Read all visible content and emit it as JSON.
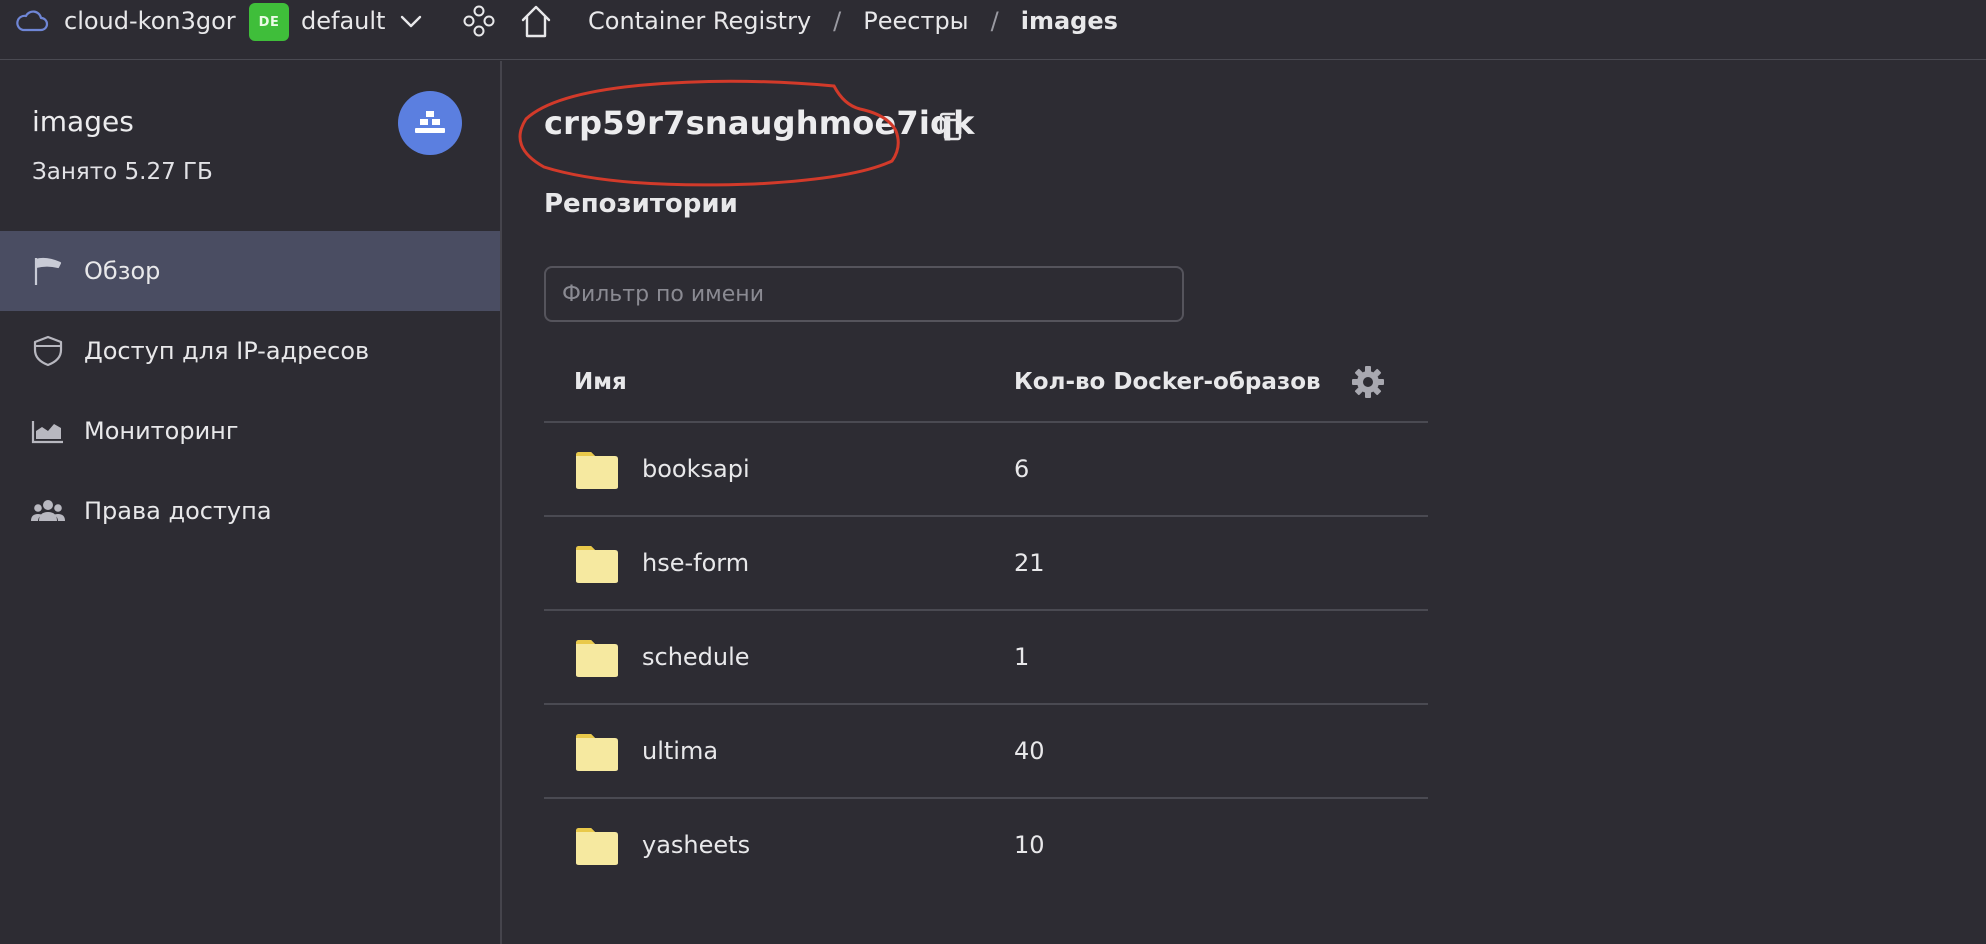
{
  "topbar": {
    "cloud_icon": "cloud-icon",
    "cloud_name": "cloud-kon3gor",
    "folder_badge": "DE",
    "folder_name": "default",
    "apps_icon": "services-icon",
    "home_icon": "home-icon",
    "breadcrumbs": [
      "Container Registry",
      "Реестры",
      "images"
    ]
  },
  "sidebar": {
    "title": "images",
    "usage": "Занято 5.27 ГБ",
    "avatar_icon": "registry-icon",
    "avatar_color": "#5b7fe0",
    "items": [
      {
        "label": "Обзор",
        "icon": "flag-icon",
        "active": true
      },
      {
        "label": "Доступ для IP-адресов",
        "icon": "shield-icon",
        "active": false
      },
      {
        "label": "Мониторинг",
        "icon": "chart-icon",
        "active": false
      },
      {
        "label": "Права доступа",
        "icon": "users-icon",
        "active": false
      }
    ]
  },
  "main": {
    "registry_id": "crp59r7snaughmoe7iqk",
    "annotation_color": "#d23a2a",
    "section_title": "Репозитории",
    "filter_placeholder": "Фильтр по имени",
    "filter_value": "",
    "table": {
      "columns": [
        "Имя",
        "Кол-во Docker-образов"
      ],
      "rows": [
        {
          "name": "booksapi",
          "count": "6"
        },
        {
          "name": "hse-form",
          "count": "21"
        },
        {
          "name": "schedule",
          "count": "1"
        },
        {
          "name": "ultima",
          "count": "40"
        },
        {
          "name": "yasheets",
          "count": "10"
        }
      ]
    }
  },
  "colors": {
    "background": "#2d2c33",
    "active_nav": "#4a4d62",
    "folder": "#f6e9a0",
    "badge": "#3fbe3a"
  }
}
